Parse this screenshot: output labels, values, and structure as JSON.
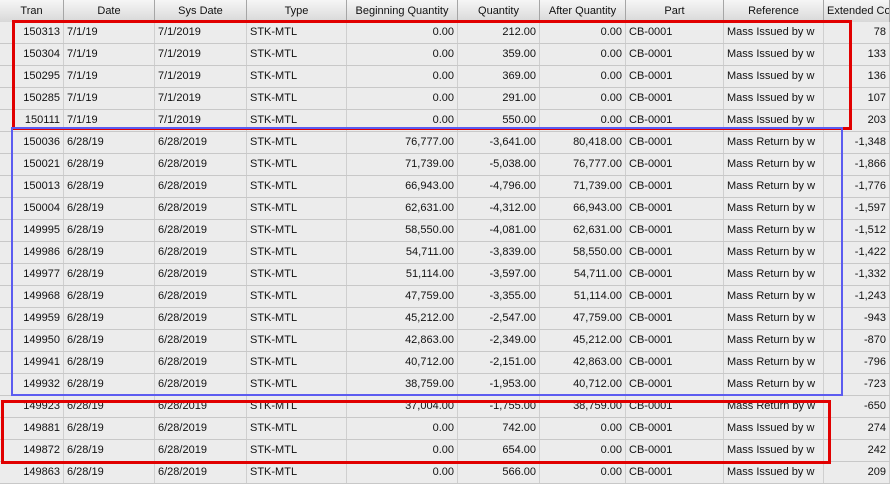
{
  "columns": [
    "Tran",
    "Date",
    "Sys Date",
    "Type",
    "Beginning Quantity",
    "Quantity",
    "After Quantity",
    "Part",
    "Reference",
    "Extended Co"
  ],
  "rows": [
    [
      "150313",
      "7/1/19",
      "7/1/2019",
      "STK-MTL",
      "0.00",
      "212.00",
      "0.00",
      "CB-0001",
      "Mass Issued by w",
      "78"
    ],
    [
      "150304",
      "7/1/19",
      "7/1/2019",
      "STK-MTL",
      "0.00",
      "359.00",
      "0.00",
      "CB-0001",
      "Mass Issued by w",
      "133"
    ],
    [
      "150295",
      "7/1/19",
      "7/1/2019",
      "STK-MTL",
      "0.00",
      "369.00",
      "0.00",
      "CB-0001",
      "Mass Issued by w",
      "136"
    ],
    [
      "150285",
      "7/1/19",
      "7/1/2019",
      "STK-MTL",
      "0.00",
      "291.00",
      "0.00",
      "CB-0001",
      "Mass Issued by w",
      "107"
    ],
    [
      "150111",
      "7/1/19",
      "7/1/2019",
      "STK-MTL",
      "0.00",
      "550.00",
      "0.00",
      "CB-0001",
      "Mass Issued by w",
      "203"
    ],
    [
      "150036",
      "6/28/19",
      "6/28/2019",
      "STK-MTL",
      "76,777.00",
      "-3,641.00",
      "80,418.00",
      "CB-0001",
      "Mass Return by w",
      "-1,348"
    ],
    [
      "150021",
      "6/28/19",
      "6/28/2019",
      "STK-MTL",
      "71,739.00",
      "-5,038.00",
      "76,777.00",
      "CB-0001",
      "Mass Return by w",
      "-1,866"
    ],
    [
      "150013",
      "6/28/19",
      "6/28/2019",
      "STK-MTL",
      "66,943.00",
      "-4,796.00",
      "71,739.00",
      "CB-0001",
      "Mass Return by w",
      "-1,776"
    ],
    [
      "150004",
      "6/28/19",
      "6/28/2019",
      "STK-MTL",
      "62,631.00",
      "-4,312.00",
      "66,943.00",
      "CB-0001",
      "Mass Return by w",
      "-1,597"
    ],
    [
      "149995",
      "6/28/19",
      "6/28/2019",
      "STK-MTL",
      "58,550.00",
      "-4,081.00",
      "62,631.00",
      "CB-0001",
      "Mass Return by w",
      "-1,512"
    ],
    [
      "149986",
      "6/28/19",
      "6/28/2019",
      "STK-MTL",
      "54,711.00",
      "-3,839.00",
      "58,550.00",
      "CB-0001",
      "Mass Return by w",
      "-1,422"
    ],
    [
      "149977",
      "6/28/19",
      "6/28/2019",
      "STK-MTL",
      "51,114.00",
      "-3,597.00",
      "54,711.00",
      "CB-0001",
      "Mass Return by w",
      "-1,332"
    ],
    [
      "149968",
      "6/28/19",
      "6/28/2019",
      "STK-MTL",
      "47,759.00",
      "-3,355.00",
      "51,114.00",
      "CB-0001",
      "Mass Return by w",
      "-1,243"
    ],
    [
      "149959",
      "6/28/19",
      "6/28/2019",
      "STK-MTL",
      "45,212.00",
      "-2,547.00",
      "47,759.00",
      "CB-0001",
      "Mass Return by w",
      "-943"
    ],
    [
      "149950",
      "6/28/19",
      "6/28/2019",
      "STK-MTL",
      "42,863.00",
      "-2,349.00",
      "45,212.00",
      "CB-0001",
      "Mass Return by w",
      "-870"
    ],
    [
      "149941",
      "6/28/19",
      "6/28/2019",
      "STK-MTL",
      "40,712.00",
      "-2,151.00",
      "42,863.00",
      "CB-0001",
      "Mass Return by w",
      "-796"
    ],
    [
      "149932",
      "6/28/19",
      "6/28/2019",
      "STK-MTL",
      "38,759.00",
      "-1,953.00",
      "40,712.00",
      "CB-0001",
      "Mass Return by w",
      "-723"
    ],
    [
      "149923",
      "6/28/19",
      "6/28/2019",
      "STK-MTL",
      "37,004.00",
      "-1,755.00",
      "38,759.00",
      "CB-0001",
      "Mass Return by w",
      "-650"
    ],
    [
      "149881",
      "6/28/19",
      "6/28/2019",
      "STK-MTL",
      "0.00",
      "742.00",
      "0.00",
      "CB-0001",
      "Mass Issued by w",
      "274"
    ],
    [
      "149872",
      "6/28/19",
      "6/28/2019",
      "STK-MTL",
      "0.00",
      "654.00",
      "0.00",
      "CB-0001",
      "Mass Issued by w",
      "242"
    ],
    [
      "149863",
      "6/28/19",
      "6/28/2019",
      "STK-MTL",
      "0.00",
      "566.00",
      "0.00",
      "CB-0001",
      "Mass Issued by w",
      "209"
    ]
  ],
  "highlight_colors": {
    "issued": "#e10000",
    "returned": "#5c5cf0"
  }
}
